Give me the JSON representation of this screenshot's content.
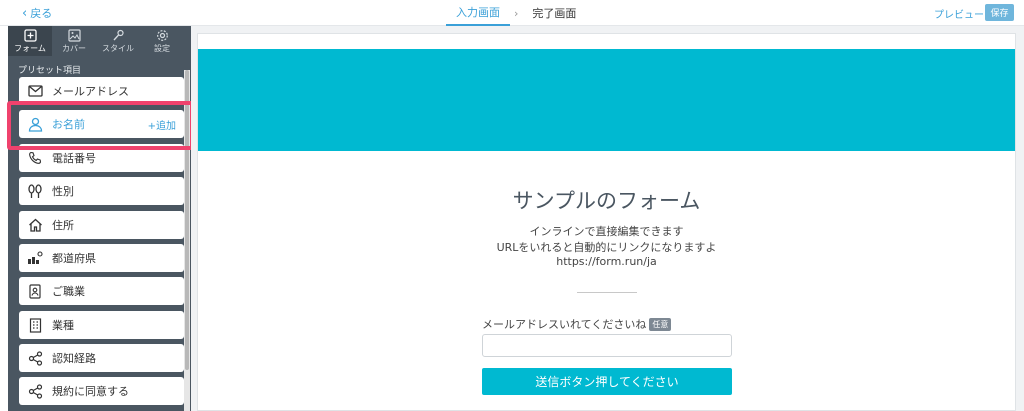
{
  "topbar": {
    "back_label": "戻る",
    "steps": [
      {
        "label": "入力画面",
        "active": true
      },
      {
        "label": "完了画面",
        "active": false
      }
    ],
    "preview_label": "プレビュー",
    "save_label": "保存"
  },
  "sidebar": {
    "tabs": [
      {
        "label": "フォーム",
        "icon": "form-icon",
        "active": true
      },
      {
        "label": "カバー",
        "icon": "image-icon",
        "active": false
      },
      {
        "label": "スタイル",
        "icon": "brush-icon",
        "active": false
      },
      {
        "label": "設定",
        "icon": "gear-icon",
        "active": false
      }
    ],
    "section_title": "プリセット項目",
    "items": [
      {
        "label": "メールアドレス",
        "icon": "mail-icon"
      },
      {
        "label": "お名前",
        "icon": "person-icon",
        "add_label": "+追加",
        "highlighted": true
      },
      {
        "label": "電話番号",
        "icon": "phone-icon"
      },
      {
        "label": "性別",
        "icon": "gender-icon"
      },
      {
        "label": "住所",
        "icon": "home-icon"
      },
      {
        "label": "都道府県",
        "icon": "map-icon"
      },
      {
        "label": "ご職業",
        "icon": "id-badge-icon"
      },
      {
        "label": "業種",
        "icon": "building-icon"
      },
      {
        "label": "認知経路",
        "icon": "share-icon"
      },
      {
        "label": "規約に同意する",
        "icon": "share-icon"
      }
    ]
  },
  "form": {
    "title": "サンプルのフォーム",
    "description_lines": [
      "インラインで直接編集できます",
      "URLをいれると自動的にリンクになりますよ",
      "https://form.run/ja"
    ],
    "field_label": "メールアドレスいれてくださいね",
    "field_badge": "任意",
    "field_value": "",
    "submit_label": "送信ボタン押してください"
  },
  "colors": {
    "accent": "#3aa0d8",
    "banner": "#00b9d1",
    "sidebar_bg": "#4a5661",
    "highlight": "#f0426d"
  }
}
